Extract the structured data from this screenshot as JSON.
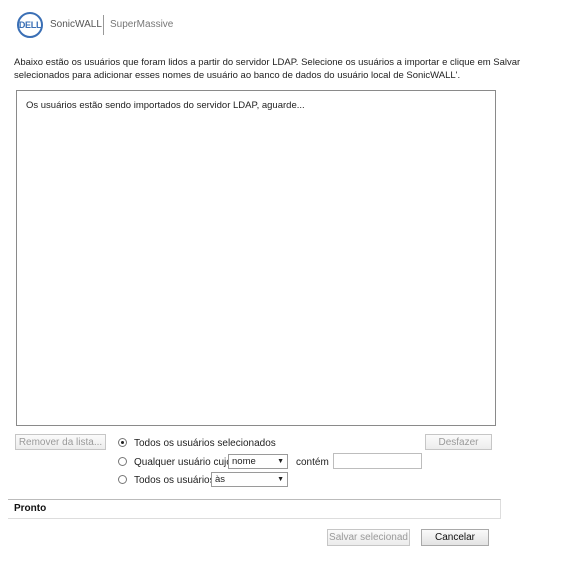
{
  "header": {
    "logo_text": "DELL",
    "brand_primary": "SonicWALL",
    "brand_secondary": "SuperMassive"
  },
  "intro": {
    "text": "Abaixo estão os usuários que foram lidos a partir do servidor LDAP. Selecione os usuários a importar e clique em Salvar selecionados para adicionar esses nomes de usuário ao banco de dados do usuário local de SonicWALL'."
  },
  "user_list": {
    "loading_message": "Os usuários estão sendo importados do servidor LDAP, aguarde..."
  },
  "controls": {
    "remove_button": "Remover da lista...",
    "undo_button": "Desfazer",
    "option_all_selected": "Todos os usuários selecionados",
    "option_any_user_whose": "Qualquer usuário cujo",
    "field_select_value": "nome",
    "contains_label": "contém",
    "contains_value": "",
    "option_all_users": "Todos os usuários",
    "as_select_value": "às",
    "selected_option": "all_selected"
  },
  "status": {
    "text": "Pronto"
  },
  "footer": {
    "save_button": "Salvar selecionad",
    "cancel_button": "Cancelar"
  },
  "colors": {
    "dell_blue": "#3a6fb5"
  }
}
